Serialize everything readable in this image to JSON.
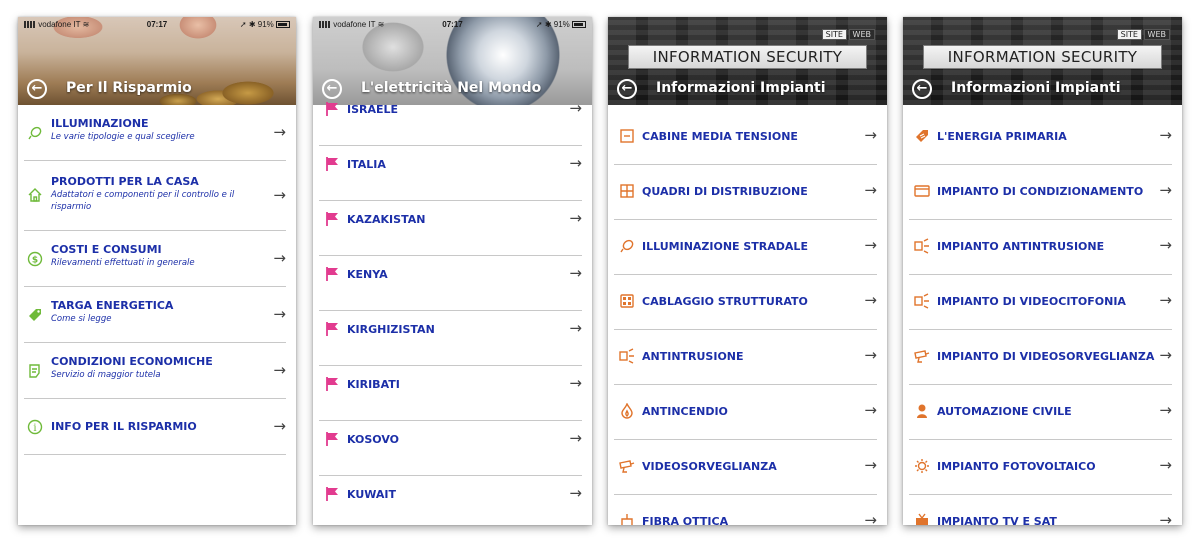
{
  "screen1": {
    "status": {
      "carrier": "vodafone IT",
      "time": "07:17",
      "battery": "91%"
    },
    "header_title": "Per Il Risparmio",
    "items": [
      {
        "title": "ILLUMINAZIONE",
        "subtitle": "Le varie tipologie e qual scegliere",
        "icon": "lightbulb-icon"
      },
      {
        "title": "PRODOTTI PER LA CASA",
        "subtitle": "Adattatori e componenti per il controllo e il risparmio",
        "icon": "house-icon"
      },
      {
        "title": "COSTI E CONSUMI",
        "subtitle": "Rilevamenti effettuati in generale",
        "icon": "dollar-coin-icon"
      },
      {
        "title": "TARGA ENERGETICA",
        "subtitle": "Come si legge",
        "icon": "tag-icon"
      },
      {
        "title": "CONDIZIONI ECONOMICHE",
        "subtitle": "Servizio di maggior tutela",
        "icon": "document-icon"
      },
      {
        "title": "INFO PER IL RISPARMIO",
        "subtitle": "",
        "icon": "info-icon"
      }
    ],
    "icon_color": "#6fba3a"
  },
  "screen2": {
    "status": {
      "carrier": "vodafone IT",
      "time": "07:17",
      "battery": "91%"
    },
    "header_title": "L'elettricità Nel Mondo",
    "items": [
      {
        "title": "ISRAELE"
      },
      {
        "title": "ITALIA"
      },
      {
        "title": "KAZAKISTAN"
      },
      {
        "title": "KENYA"
      },
      {
        "title": "KIRGHIZISTAN"
      },
      {
        "title": "KIRIBATI"
      },
      {
        "title": "KOSOVO"
      },
      {
        "title": "KUWAIT"
      }
    ],
    "icon": "flag-icon",
    "icon_color": "#e23b8f"
  },
  "screen3": {
    "banner": "INFORMATION SECURITY",
    "tags": [
      "SITE",
      "WEB"
    ],
    "header_title": "Informazioni Impianti",
    "items": [
      {
        "title": "CABINE MEDIA TENSIONE",
        "icon": "cabinet-icon"
      },
      {
        "title": "QUADRI DI DISTRIBUZIONE",
        "icon": "grid-panel-icon"
      },
      {
        "title": "ILLUMINAZIONE STRADALE",
        "icon": "lightbulb-icon"
      },
      {
        "title": "CABLAGGIO STRUTTURATO",
        "icon": "network-socket-icon"
      },
      {
        "title": "ANTINTRUSIONE",
        "icon": "intrusion-sensor-icon"
      },
      {
        "title": "ANTINCENDIO",
        "icon": "fire-icon"
      },
      {
        "title": "VIDEOSORVEGLIANZA",
        "icon": "camera-icon"
      },
      {
        "title": "FIBRA OTTICA",
        "icon": "fiber-icon"
      }
    ],
    "icon_color": "#e0742c"
  },
  "screen4": {
    "banner": "INFORMATION SECURITY",
    "tags": [
      "SITE",
      "WEB"
    ],
    "header_title": "Informazioni Impianti",
    "items": [
      {
        "title": "L'ENERGIA PRIMARIA",
        "icon": "energy-tag-icon"
      },
      {
        "title": "IMPIANTO DI CONDIZIONAMENTO",
        "icon": "air-conditioner-icon"
      },
      {
        "title": "IMPIANTO ANTINTRUSIONE",
        "icon": "intrusion-sensor-icon"
      },
      {
        "title": "IMPIANTO DI VIDEOCITOFONIA",
        "icon": "intercom-icon"
      },
      {
        "title": "IMPIANTO DI VIDEOSORVEGLIANZA",
        "icon": "camera-icon"
      },
      {
        "title": "AUTOMAZIONE CIVILE",
        "icon": "person-icon"
      },
      {
        "title": "IMPIANTO FOTOVOLTAICO",
        "icon": "sun-icon"
      },
      {
        "title": "IMPIANTO TV E SAT",
        "icon": "tv-icon"
      }
    ],
    "icon_color": "#e0742c"
  }
}
